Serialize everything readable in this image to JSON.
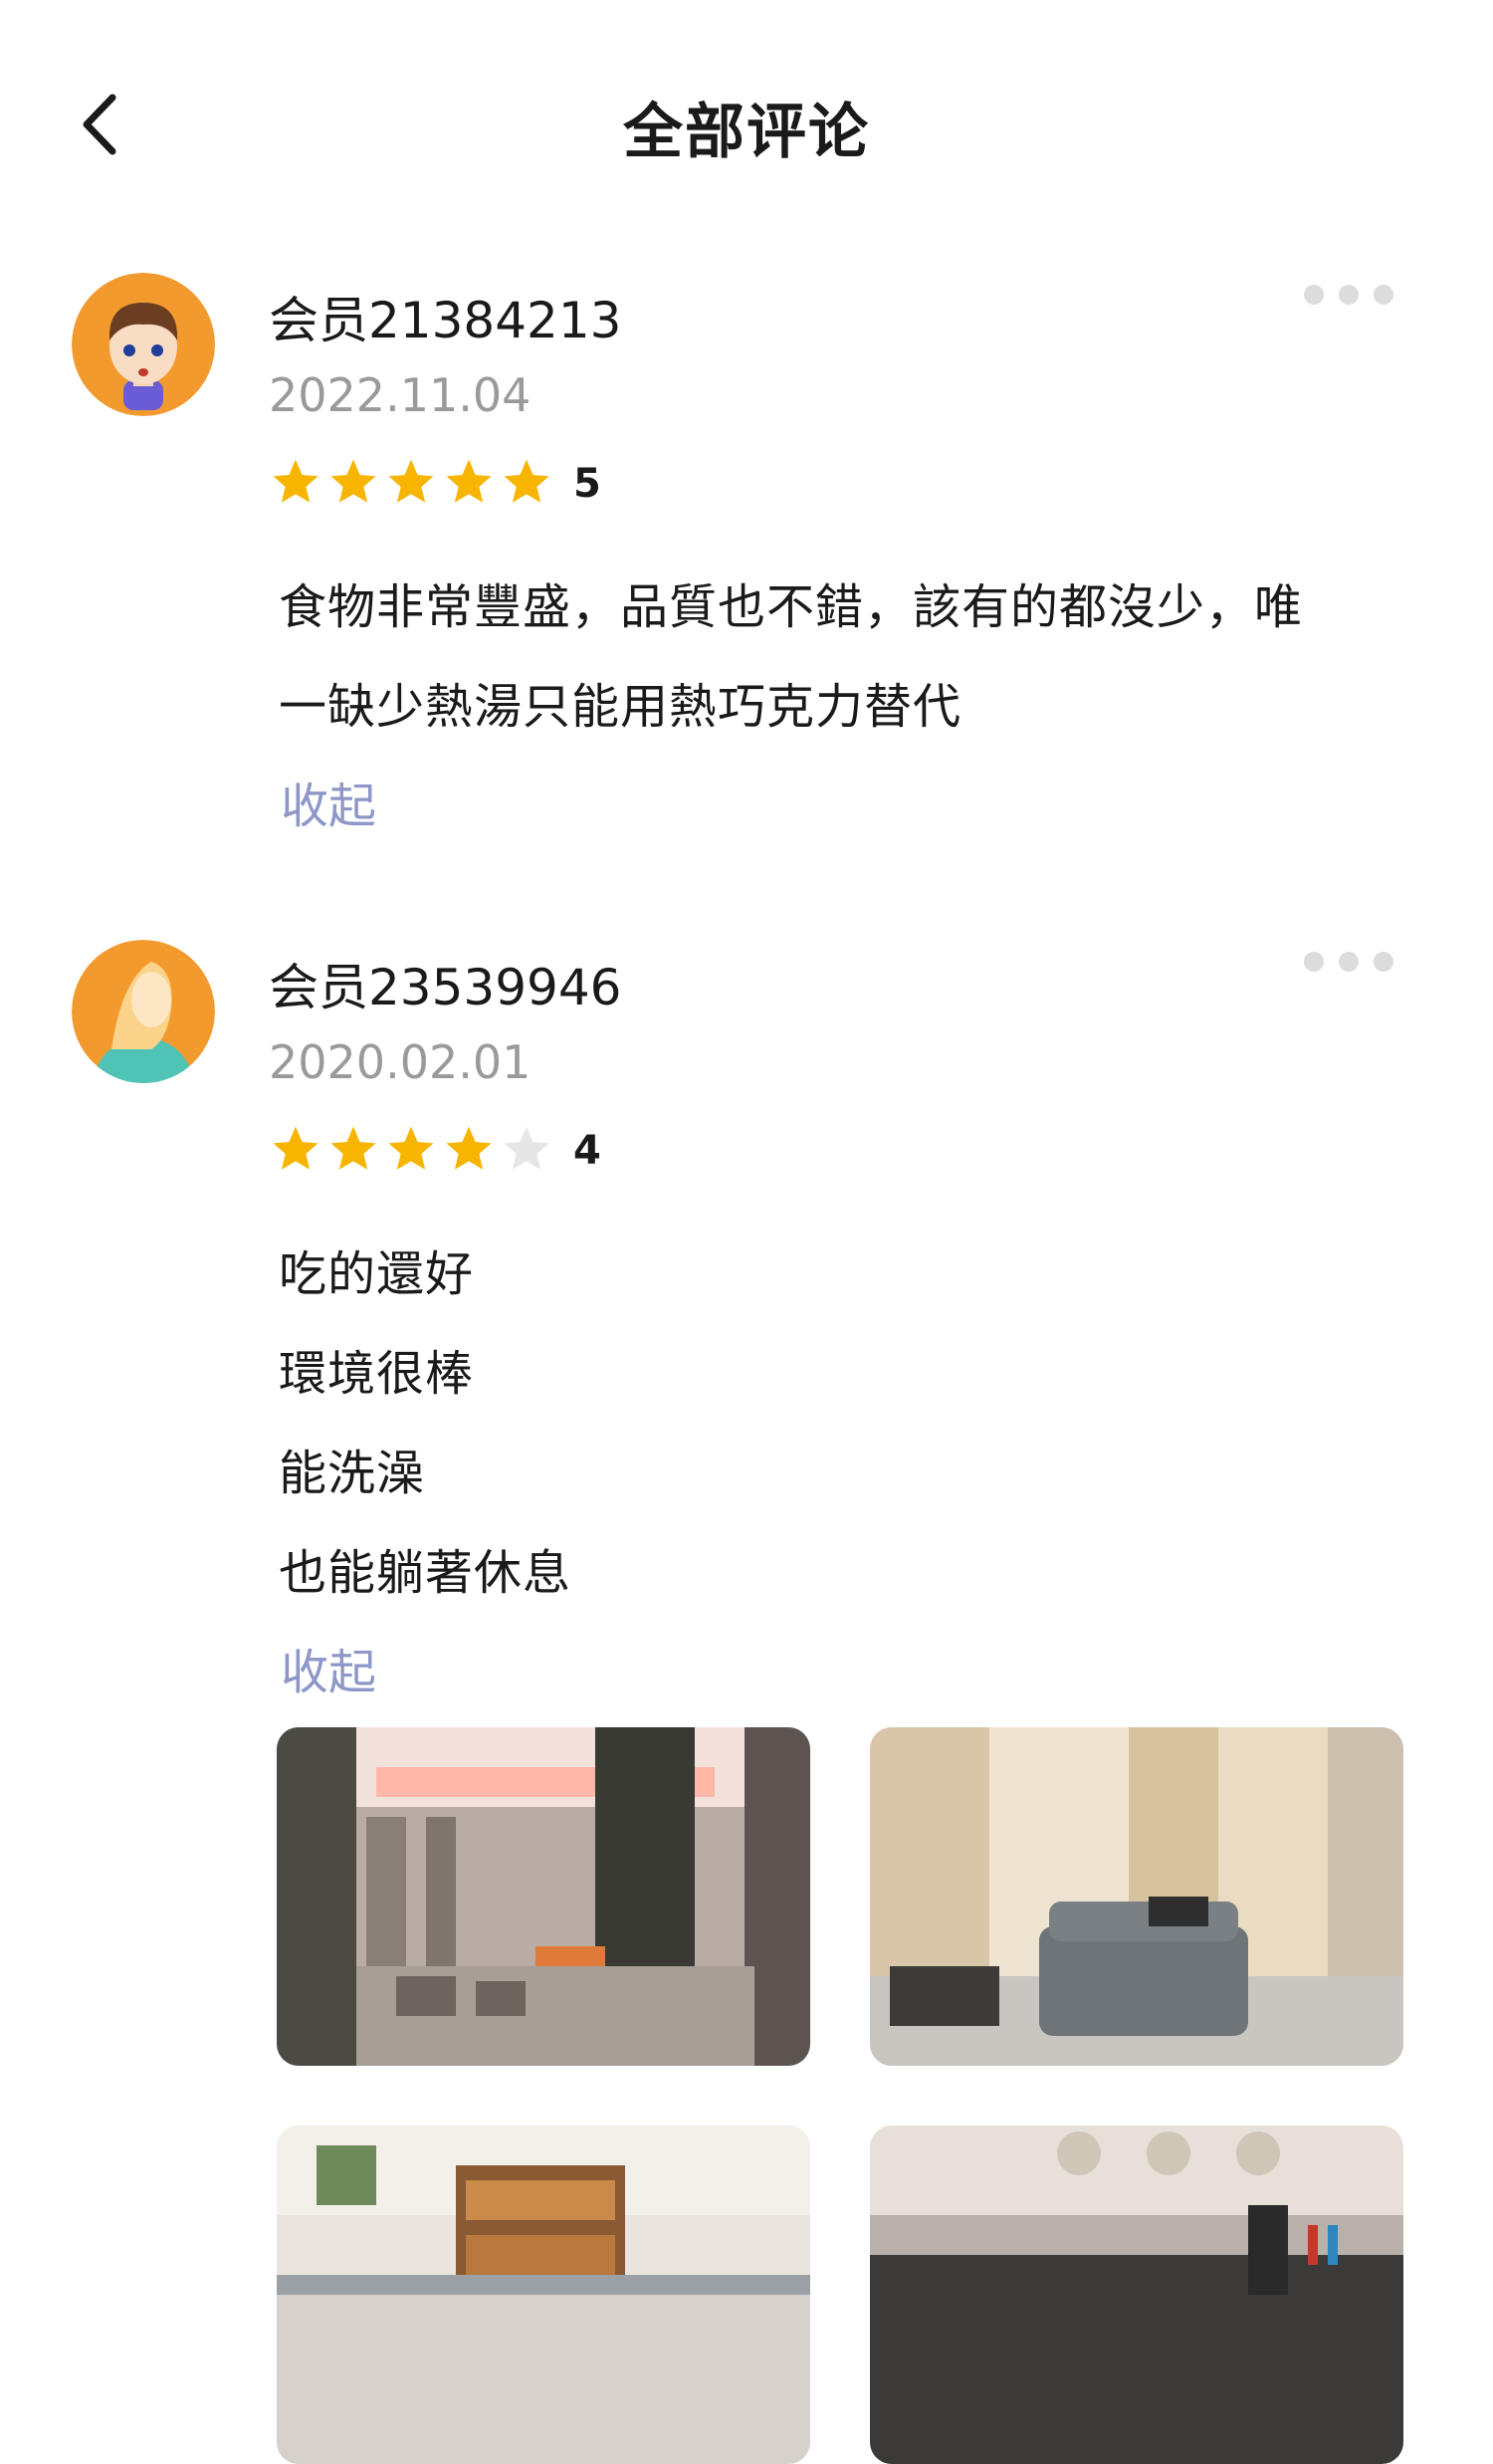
{
  "header": {
    "title": "全部评论",
    "back_icon": "chevron-left-icon"
  },
  "colors": {
    "star_on": "#F7B500",
    "star_off": "#E6E6E6",
    "link": "#8D97C8",
    "date": "#9A9A9A"
  },
  "reviews": [
    {
      "username": "会员21384213",
      "date": "2022.11.04",
      "rating": 5,
      "rating_label": "5",
      "lines": [
        "食物非常豐盛，品質也不錯，該有的都沒少，唯",
        "一缺少熱湯只能用熱巧克力替代"
      ],
      "collapse_label": "收起"
    },
    {
      "username": "会员23539946",
      "date": "2020.02.01",
      "rating": 4,
      "rating_label": "4",
      "lines": [
        "吃的還好",
        "環境很棒",
        "能洗澡",
        "也能躺著休息"
      ],
      "collapse_label": "收起",
      "photos": [
        "lounge-seating-photo",
        "recliner-pods-photo",
        "bakery-buffet-photo",
        "bar-counter-photo"
      ]
    }
  ]
}
